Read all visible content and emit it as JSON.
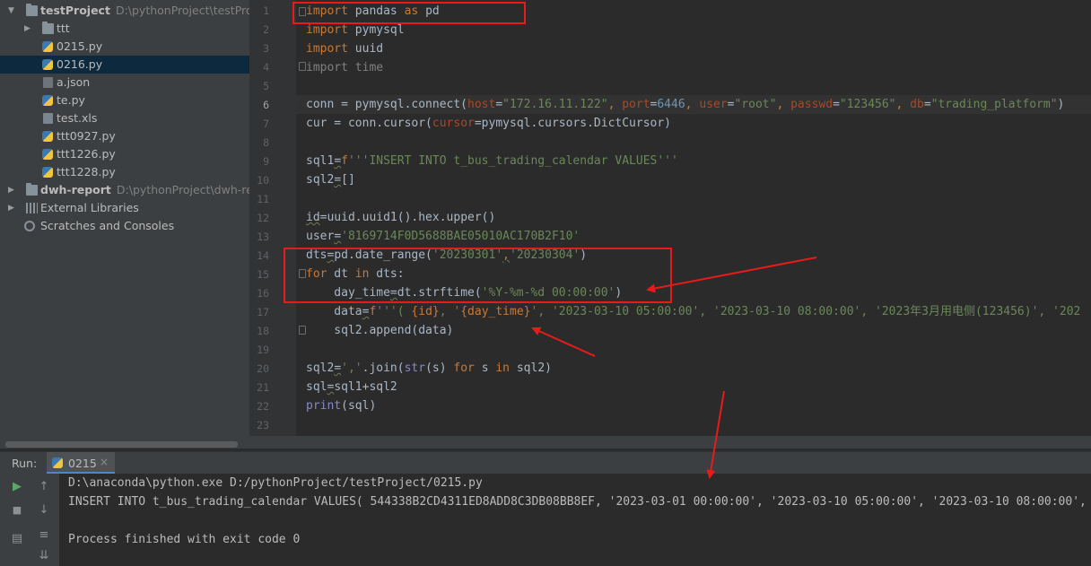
{
  "project_tree": {
    "items": [
      {
        "label": "testProject",
        "path": "D:\\pythonProject\\testProject",
        "type": "project"
      },
      {
        "label": "ttt",
        "type": "folder"
      },
      {
        "label": "0215.py",
        "type": "py"
      },
      {
        "label": "0216.py",
        "type": "py",
        "selected": true
      },
      {
        "label": "a.json",
        "type": "json"
      },
      {
        "label": "te.py",
        "type": "py"
      },
      {
        "label": "test.xls",
        "type": "xls"
      },
      {
        "label": "ttt0927.py",
        "type": "py"
      },
      {
        "label": "ttt1226.py",
        "type": "py"
      },
      {
        "label": "ttt1228.py",
        "type": "py"
      },
      {
        "label": "dwh-report",
        "path": "D:\\pythonProject\\dwh-report",
        "type": "project"
      },
      {
        "label": "External Libraries",
        "type": "lib"
      },
      {
        "label": "Scratches and Consoles",
        "type": "scratch"
      }
    ]
  },
  "editor": {
    "line_numbers": [
      "1",
      "2",
      "3",
      "4",
      "5",
      "6",
      "7",
      "8",
      "9",
      "10",
      "11",
      "12",
      "13",
      "14",
      "15",
      "16",
      "17",
      "18",
      "19",
      "20",
      "21",
      "22",
      "23"
    ],
    "lines": {
      "l1": {
        "kw1": "import",
        "rest": " pandas ",
        "kw2": "as",
        "rest2": " pd"
      },
      "l2": {
        "kw1": "import",
        "rest": " pymysql"
      },
      "l3": {
        "kw1": "import",
        "rest": " uuid"
      },
      "l4": {
        "kw1": "import",
        "rest": " time"
      },
      "l6": {
        "a": "conn = pymysql.connect(",
        "p1": "host",
        "s1": "\"172.16.11.122\"",
        "p2": "port",
        "n2": "6446",
        "p3": "user",
        "s3": "\"root\"",
        "p4": "passwd",
        "s4": "\"123456\"",
        "p5": "db",
        "s5": "\"trading_platform\"",
        "close": ")"
      },
      "l7": {
        "a": "cur = conn.cursor(",
        "p1": "cursor",
        "b": "=pymysql.cursors.DictCursor)"
      },
      "l9": {
        "a": "sql1",
        "eq": "=",
        "pre": "f",
        "s": "'''INSERT INTO t_bus_trading_calendar VALUES'''"
      },
      "l10": {
        "a": "sql2",
        "eq": "=",
        "b": "[]"
      },
      "l12": {
        "a": "id",
        "eq": "=",
        "b": "uuid.uuid1().hex.upper()"
      },
      "l13": {
        "a": "user",
        "eq": "=",
        "s": "'8169714F0D5688BAE05010AC170B2F10'"
      },
      "l14": {
        "a": "dts",
        "eq": "=",
        "b": "pd.date_range(",
        "s1": "'20230301'",
        "c": ",",
        "s2": "'20230304'",
        "d": ")"
      },
      "l15": {
        "kw1": "for",
        "b": " dt ",
        "kw2": "in",
        "c": " dts:"
      },
      "l16": {
        "a": "    day_time",
        "eq": "=",
        "b": "dt.strftime(",
        "s": "'%Y-%m-%d 00:00:00'",
        "c": ")"
      },
      "l17": {
        "a": "    data",
        "eq": "=",
        "pre": "f",
        "s1": "'''( ",
        "v1": "{id}",
        "s2": ", '",
        "v2": "{day_time}",
        "s3": "', '2023-03-10 05:00:00', '2023-03-10 08:00:00', '2023年3月用电侧(123456)', '202"
      },
      "l18": {
        "a": "    sql2.append(data)"
      },
      "l20": {
        "a": "sql2",
        "eq": "=",
        "s": "','",
        "b": ".join(",
        "bi": "str",
        "c": "(s) ",
        "kw1": "for",
        "d": " s ",
        "kw2": "in",
        "e": " sql2)"
      },
      "l21": {
        "a": "sql",
        "eq": "=",
        "b": "sql1+sql2"
      },
      "l22": {
        "bi": "print",
        "b": "(sql)"
      }
    }
  },
  "run_panel": {
    "label": "Run:",
    "tab_label": "0215",
    "console_lines": [
      "D:\\anaconda\\python.exe D:/pythonProject/testProject/0215.py",
      "INSERT INTO t_bus_trading_calendar VALUES( 544338B2CD4311ED8ADD8C3DB08BB8EF, '2023-03-01 00:00:00', '2023-03-10 05:00:00', '2023-03-10 08:00:00',",
      "",
      "Process finished with exit code 0"
    ]
  },
  "colors": {
    "keyword": "#cc7832",
    "string": "#6a8759",
    "number": "#6897bb",
    "param": "#aa4926",
    "annotation": "#e81b1b"
  }
}
